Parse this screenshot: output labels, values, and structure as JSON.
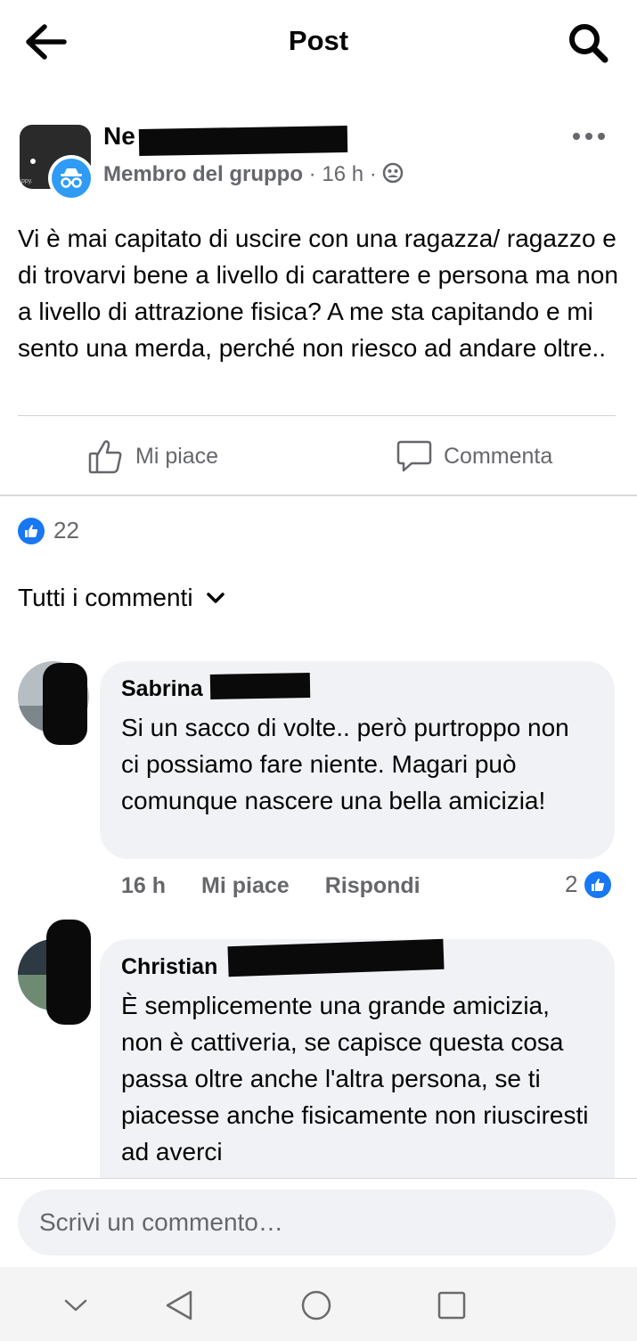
{
  "header": {
    "title": "Post",
    "back_icon": "arrow-left-icon",
    "search_icon": "search-icon"
  },
  "post": {
    "author_visible": "Ne",
    "author_badge": "Membro del gruppo",
    "time": "16 h",
    "separator": "·",
    "privacy_icon": "group-icon",
    "text": "Vi è mai capitato di uscire con una ragazza/ ragazzo e di trovarvi bene a livello di carattere e persona ma non a livello di attrazione fisica? A me sta capitando e mi sento una merda, perché non riesco ad andare oltre..",
    "actions": {
      "like": "Mi piace",
      "comment": "Commenta"
    },
    "reaction_count": "22"
  },
  "sort_label": "Tutti i commenti",
  "comments": [
    {
      "name": "Sabrina",
      "text": "Si un sacco di volte.. però purtroppo non ci possiamo fare niente. Magari può comunque nascere una bella amicizia!",
      "time": "16 h",
      "like": "Mi piace",
      "reply": "Rispondi",
      "reactions": "2"
    },
    {
      "name": "Christian",
      "text": "È semplicemente una grande amicizia, non è cattiveria, se capisce questa cosa passa oltre anche l'altra persona, se ti piacesse anche fisicamente non riusciresti ad averci"
    }
  ],
  "composer": {
    "placeholder": "Scrivi un commento…"
  },
  "colors": {
    "accent": "#1877f2",
    "secondary_text": "#65676b",
    "bubble": "#f0f2f5"
  }
}
